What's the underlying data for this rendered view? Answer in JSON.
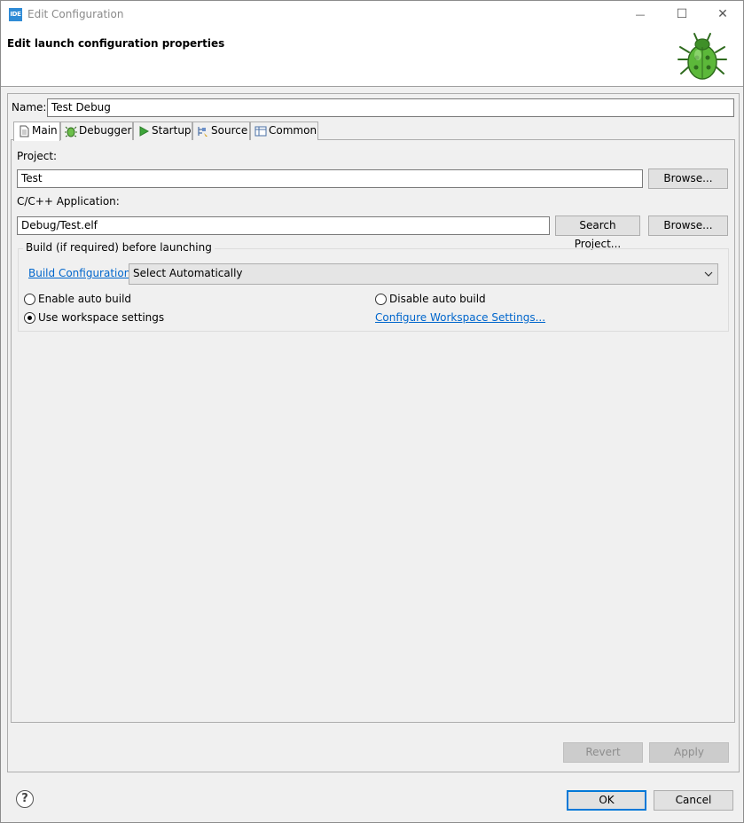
{
  "window": {
    "title": "Edit Configuration",
    "app_icon_text": "IDE",
    "minimize_glyph": "—",
    "maximize_glyph": "☐",
    "close_glyph": "✕"
  },
  "header": {
    "title": "Edit launch configuration properties",
    "icon": "bug-icon"
  },
  "name_field": {
    "label": "Name:",
    "value": "Test Debug"
  },
  "tabs": [
    {
      "label": "Main",
      "icon": "document-icon",
      "active": true
    },
    {
      "label": "Debugger",
      "icon": "debug-bug-icon",
      "active": false
    },
    {
      "label": "Startup",
      "icon": "play-icon",
      "active": false
    },
    {
      "label": "Source",
      "icon": "source-icon",
      "active": false
    },
    {
      "label": "Common",
      "icon": "table-icon",
      "active": false
    }
  ],
  "main_tab": {
    "project_label": "Project:",
    "project_value": "Test",
    "project_browse": "Browse...",
    "app_label": "C/C++ Application:",
    "app_value": "Debug/Test.elf",
    "search_project": "Search Project...",
    "app_browse": "Browse...",
    "build_group": {
      "title": "Build (if required) before launching",
      "config_link": "Build Configuration:",
      "config_selected": "Select Automatically",
      "enable_auto_build": "Enable auto build",
      "disable_auto_build": "Disable auto build",
      "use_workspace": "Use workspace settings",
      "configure_link": "Configure Workspace Settings...",
      "selected_option": "use_workspace"
    }
  },
  "actions": {
    "revert": "Revert",
    "apply": "Apply",
    "ok": "OK",
    "cancel": "Cancel",
    "help_glyph": "?"
  },
  "colors": {
    "link": "#0066cc",
    "default_button_border": "#0078d7",
    "app_icon": "#2f8bd6"
  }
}
